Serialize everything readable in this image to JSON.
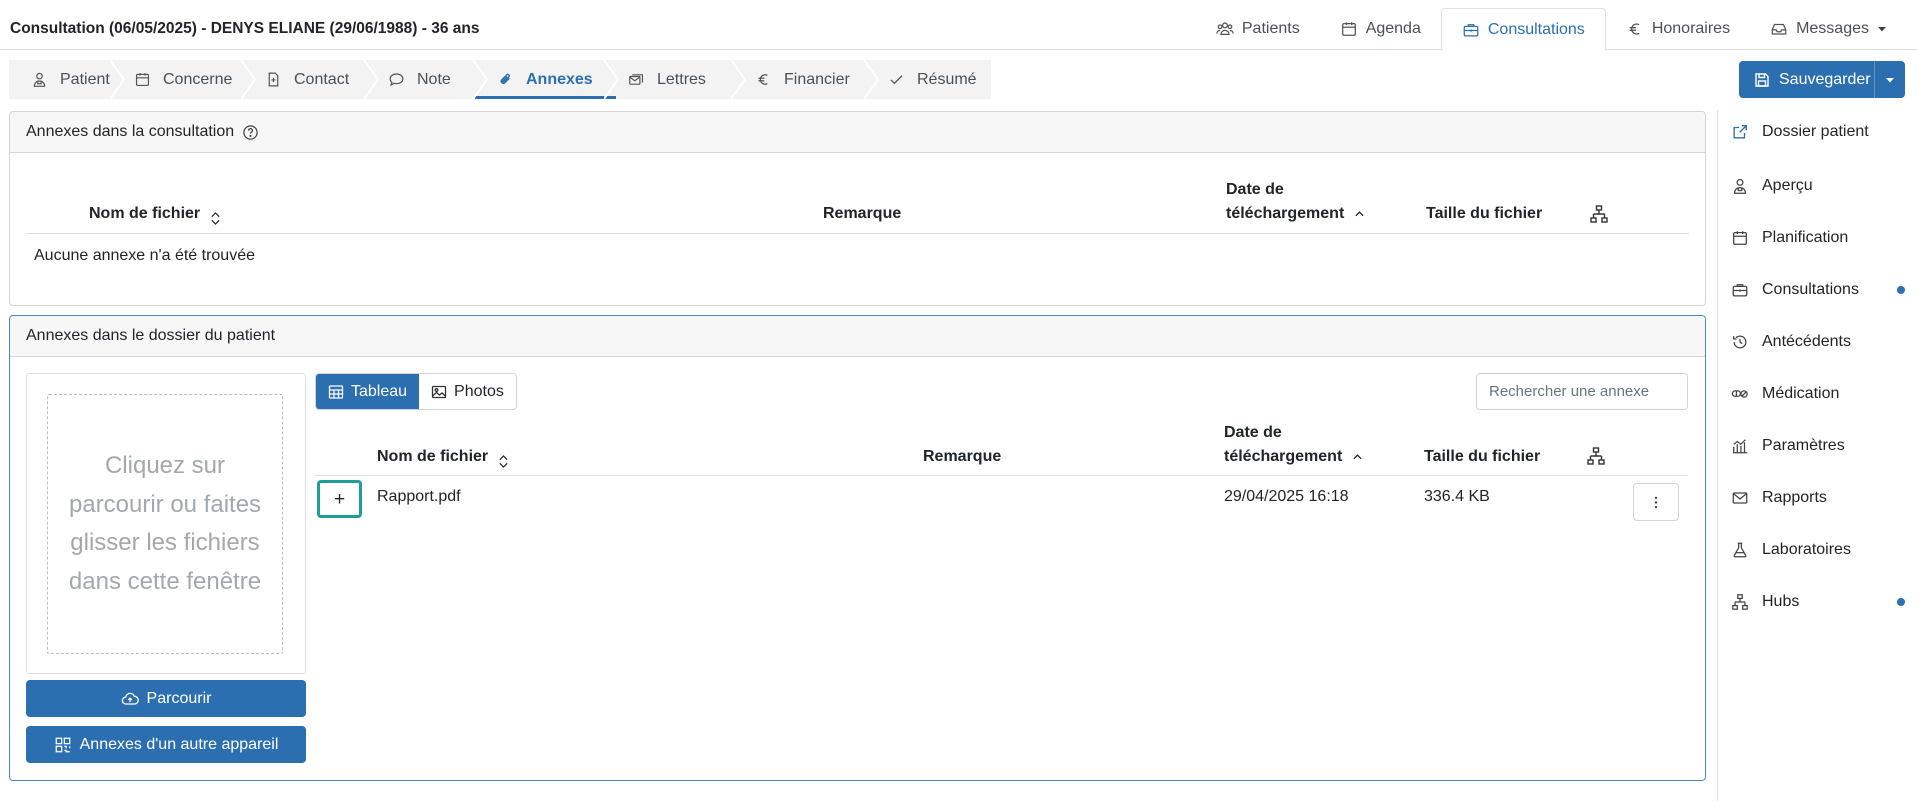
{
  "header": {
    "title": "Consultation (06/05/2025) - DENYS ELIANE (29/06/1988) - 36 ans"
  },
  "top_nav": [
    {
      "label": "Patients",
      "icon": "users-icon",
      "active": false
    },
    {
      "label": "Agenda",
      "icon": "calendar-icon",
      "active": false
    },
    {
      "label": "Consultations",
      "icon": "briefcase-icon",
      "active": true
    },
    {
      "label": "Honoraires",
      "icon": "euro-icon",
      "active": false
    },
    {
      "label": "Messages",
      "icon": "inbox-icon",
      "active": false
    }
  ],
  "steps": [
    {
      "label": "Patient",
      "icon": "user-doctor-icon",
      "active": false
    },
    {
      "label": "Concerne",
      "icon": "calendar-icon",
      "active": false
    },
    {
      "label": "Contact",
      "icon": "medical-file-icon",
      "active": false
    },
    {
      "label": "Note",
      "icon": "speech-bubble-icon",
      "active": false
    },
    {
      "label": "Annexes",
      "icon": "paperclip-icon",
      "active": true
    },
    {
      "label": "Lettres",
      "icon": "mail-stack-icon",
      "active": false
    },
    {
      "label": "Financier",
      "icon": "euro-icon",
      "active": false
    },
    {
      "label": "Résumé",
      "icon": "check-icon",
      "active": false
    }
  ],
  "save_button": {
    "label": "Sauvegarder"
  },
  "consultation_panel": {
    "title": "Annexes dans la consultation",
    "columns": {
      "filename": "Nom de fichier",
      "remark": "Remarque",
      "date_line1": "Date de",
      "date_line2": "téléchargement",
      "size": "Taille du fichier"
    },
    "empty_text": "Aucune annexe n'a été trouvée"
  },
  "patient_panel": {
    "title": "Annexes dans le dossier du patient",
    "dropzone_text": "Cliquez sur parcourir ou faites glisser les fichiers dans cette fenêtre",
    "browse_label": "Parcourir",
    "other_device_label": "Annexes d'un autre appareil",
    "view_toggle": {
      "table": "Tableau",
      "photos": "Photos",
      "selected": "Tableau"
    },
    "search_placeholder": "Rechercher une annexe",
    "columns": {
      "filename": "Nom de fichier",
      "remark": "Remarque",
      "date_line1": "Date de",
      "date_line2": "téléchargement",
      "size": "Taille du fichier"
    },
    "rows": [
      {
        "expand": "+",
        "filename": "Rapport.pdf",
        "remark": "",
        "date": "29/04/2025 16:18",
        "size": "336.4 KB"
      }
    ]
  },
  "sidebar": {
    "items": [
      {
        "label": "Dossier patient",
        "icon": "external-link-icon",
        "dot": false
      },
      {
        "label": "Aperçu",
        "icon": "user-doctor-icon",
        "dot": false
      },
      {
        "label": "Planification",
        "icon": "calendar-icon",
        "dot": false
      },
      {
        "label": "Consultations",
        "icon": "briefcase-icon",
        "dot": true
      },
      {
        "label": "Antécédents",
        "icon": "history-icon",
        "dot": false
      },
      {
        "label": "Médication",
        "icon": "pills-icon",
        "dot": false
      },
      {
        "label": "Paramètres",
        "icon": "chart-bars-icon",
        "dot": false
      },
      {
        "label": "Rapports",
        "icon": "envelope-icon",
        "dot": false
      },
      {
        "label": "Laboratoires",
        "icon": "flask-icon",
        "dot": false
      },
      {
        "label": "Hubs",
        "icon": "network-icon",
        "dot": true
      }
    ]
  },
  "colors": {
    "primary": "#2c6fb0",
    "highlight_border": "#1f9c9c",
    "panel_header_bg": "#f7f7f7"
  }
}
